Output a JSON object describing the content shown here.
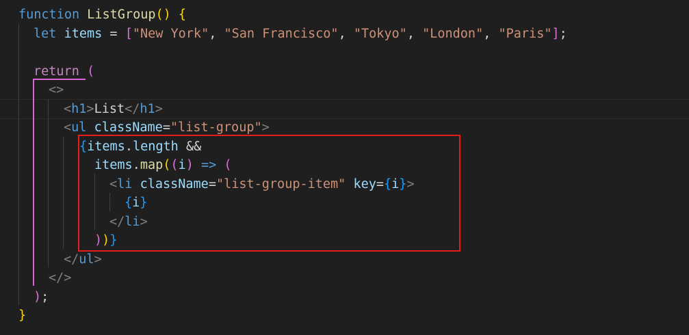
{
  "colors": {
    "background": "#1f1f1f",
    "keyword": "#569cd6",
    "control_keyword": "#c586c0",
    "function_name": "#dcdcaa",
    "variable": "#9cdcfe",
    "string": "#ce9178",
    "jsx_tag": "#569cd6",
    "angle_bracket": "#808080",
    "bracket_level_1": "#ffd700",
    "bracket_level_2": "#da70d6",
    "bracket_level_3": "#179fff",
    "highlight_box": "#e51d1d"
  },
  "code": {
    "l1": {
      "kw": "function",
      "name": "ListGroup",
      "open": "()",
      "brace": "{"
    },
    "l2": {
      "kw": "let",
      "var": "items",
      "eq": "=",
      "open": "[",
      "s1": "\"New York\"",
      "c1": ",",
      "s2": "\"San Francisco\"",
      "c2": ",",
      "s3": "\"Tokyo\"",
      "c3": ",",
      "s4": "\"London\"",
      "c4": ",",
      "s5": "\"Paris\"",
      "close": "]",
      "semi": ";"
    },
    "l4": {
      "kw": "return",
      "paren": "("
    },
    "l5": {
      "frag": "<>"
    },
    "l6": {
      "lt": "<",
      "tag": "h1",
      "gt": ">",
      "text": "List",
      "lt2": "</",
      "tag2": "h1",
      "gt2": ">"
    },
    "l7": {
      "lt": "<",
      "tag": "ul",
      "attr": "className",
      "eq": "=",
      "val": "\"list-group\"",
      "gt": ">"
    },
    "l8": {
      "brace": "{",
      "var": "items",
      "dot": ".",
      "prop": "length",
      "op": "&&"
    },
    "l9": {
      "var": "items",
      "dot": ".",
      "fn": "map",
      "p1": "(",
      "p2": "(",
      "arg": "i",
      "p3": ")",
      "arrow": "=>",
      "p4": "("
    },
    "l10": {
      "lt": "<",
      "tag": "li",
      "attr": "className",
      "eq": "=",
      "val": "\"list-group-item\"",
      "attr2": "key",
      "eq2": "=",
      "b1": "{",
      "arg": "i",
      "b2": "}",
      "gt": ">"
    },
    "l11": {
      "b1": "{",
      "arg": "i",
      "b2": "}"
    },
    "l12": {
      "lt": "</",
      "tag": "li",
      "gt": ">"
    },
    "l13": {
      "p1": ")",
      "p2": ")",
      "brace": "}"
    },
    "l14": {
      "lt": "</",
      "tag": "ul",
      "gt": ">"
    },
    "l15": {
      "frag": "</>"
    },
    "l16": {
      "paren": ")",
      "semi": ";"
    },
    "l17": {
      "brace": "}"
    }
  }
}
